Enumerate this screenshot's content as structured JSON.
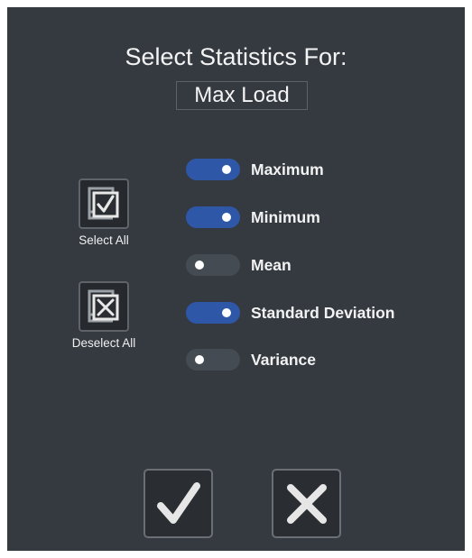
{
  "dialog": {
    "title": "Select Statistics For:",
    "subject": "Max Load"
  },
  "side_buttons": {
    "select_all": {
      "label": "Select All",
      "icon": "checkbox-checked-icon"
    },
    "deselect_all": {
      "label": "Deselect All",
      "icon": "checkbox-crossed-icon"
    }
  },
  "statistics": [
    {
      "label": "Maximum",
      "enabled": true
    },
    {
      "label": "Minimum",
      "enabled": true
    },
    {
      "label": "Mean",
      "enabled": false
    },
    {
      "label": "Standard Deviation",
      "enabled": true
    },
    {
      "label": "Variance",
      "enabled": false
    }
  ],
  "actions": {
    "confirm_icon": "checkmark-icon",
    "cancel_icon": "x-icon"
  },
  "colors": {
    "panel_bg": "#343a40",
    "toggle_on": "#2f57a8",
    "toggle_off": "#454b52"
  }
}
